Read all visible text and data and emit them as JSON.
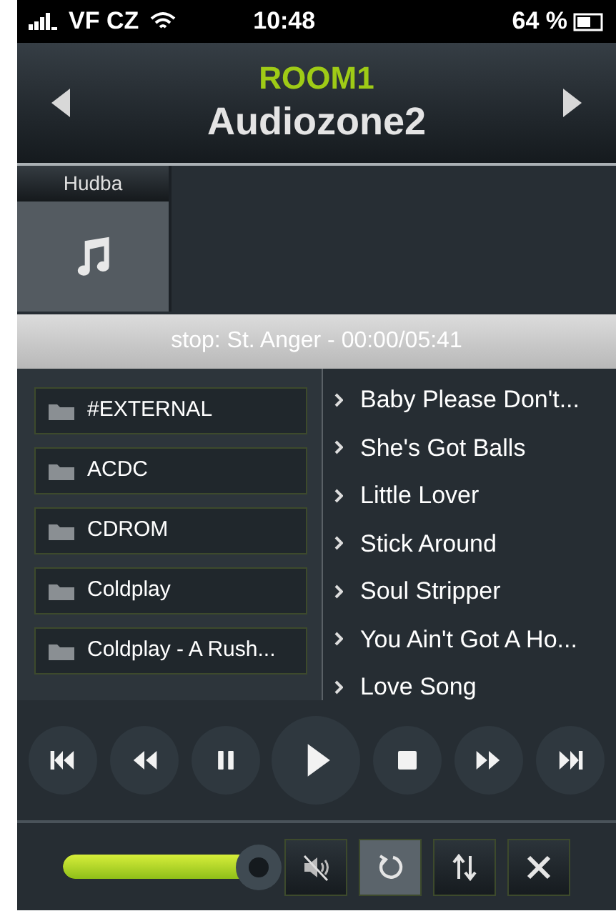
{
  "status_bar": {
    "carrier": "VF CZ",
    "time": "10:48",
    "battery": "64 %"
  },
  "header": {
    "room": "ROOM1",
    "zone": "Audiozone2"
  },
  "sources": [
    {
      "label": "Hudba",
      "selected": true
    }
  ],
  "now_playing": "stop: St. Anger - 00:00/05:41",
  "folders": [
    {
      "label": "#EXTERNAL"
    },
    {
      "label": "ACDC"
    },
    {
      "label": "CDROM"
    },
    {
      "label": "Coldplay"
    },
    {
      "label": "Coldplay - A Rush..."
    }
  ],
  "tracks": [
    {
      "label": "Baby Please Don't..."
    },
    {
      "label": "She's Got Balls"
    },
    {
      "label": "Little Lover"
    },
    {
      "label": "Stick Around"
    },
    {
      "label": "Soul Stripper"
    },
    {
      "label": "You Ain't Got A Ho..."
    },
    {
      "label": "Love Song"
    }
  ],
  "transport": [
    {
      "kind": "first"
    },
    {
      "kind": "rewind"
    },
    {
      "kind": "pause"
    },
    {
      "kind": "play"
    },
    {
      "kind": "stop"
    },
    {
      "kind": "forward"
    },
    {
      "kind": "last"
    }
  ],
  "volume": {
    "level": 1
  },
  "toggles": [
    {
      "kind": "mute",
      "on": false
    },
    {
      "kind": "repeat",
      "on": true
    },
    {
      "kind": "shuffle",
      "on": false
    },
    {
      "kind": "close",
      "on": false
    }
  ]
}
